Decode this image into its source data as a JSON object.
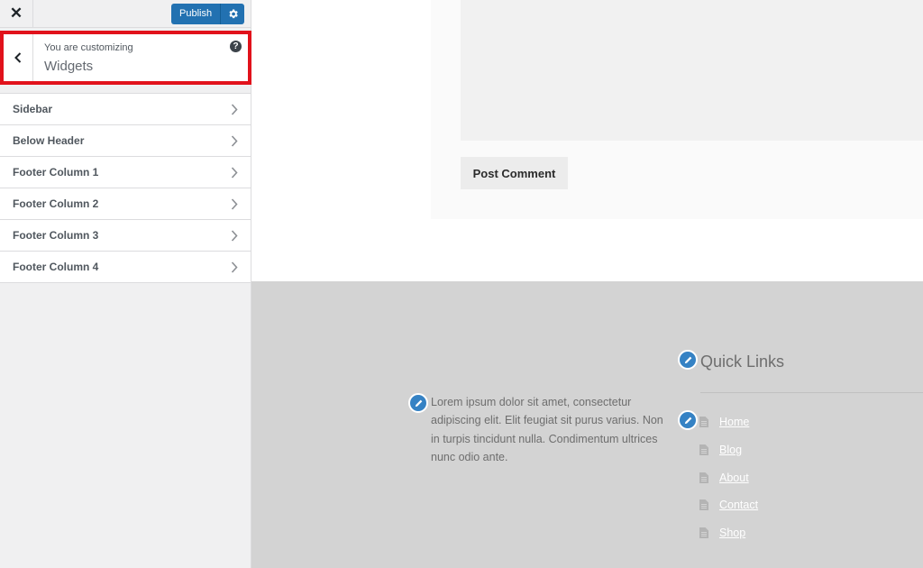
{
  "customizer": {
    "close_label": "✕",
    "publish_label": "Publish",
    "customizing_label": "You are customizing",
    "panel_title": "Widgets",
    "help_label": "?",
    "sections": [
      {
        "label": "Sidebar"
      },
      {
        "label": "Below Header"
      },
      {
        "label": "Footer Column 1"
      },
      {
        "label": "Footer Column 2"
      },
      {
        "label": "Footer Column 3"
      },
      {
        "label": "Footer Column 4"
      }
    ]
  },
  "preview": {
    "post_comment_label": "Post Comment",
    "footer": {
      "text_widget": "Lorem ipsum dolor sit amet, consectetur adipiscing elit. Elit feugiat sit purus varius. Non in turpis tincidunt nulla. Condimentum ultrices nunc odio ante.",
      "quick_links_title": "Quick Links",
      "links": [
        {
          "label": "Home"
        },
        {
          "label": "Blog"
        },
        {
          "label": "About"
        },
        {
          "label": "Contact"
        },
        {
          "label": "Shop"
        }
      ]
    }
  },
  "colors": {
    "accent": "#2271b1",
    "highlight_border": "#e1121b",
    "edit_shortcut": "#3582c4",
    "footer_bg": "#d3d3d3"
  },
  "icons": {
    "close": "close-icon",
    "settings": "gear-icon",
    "back": "chevron-left-icon",
    "help": "help-icon",
    "section_arrow": "chevron-right-icon",
    "edit_shortcut": "pencil-icon",
    "link_bullet": "document-icon"
  }
}
